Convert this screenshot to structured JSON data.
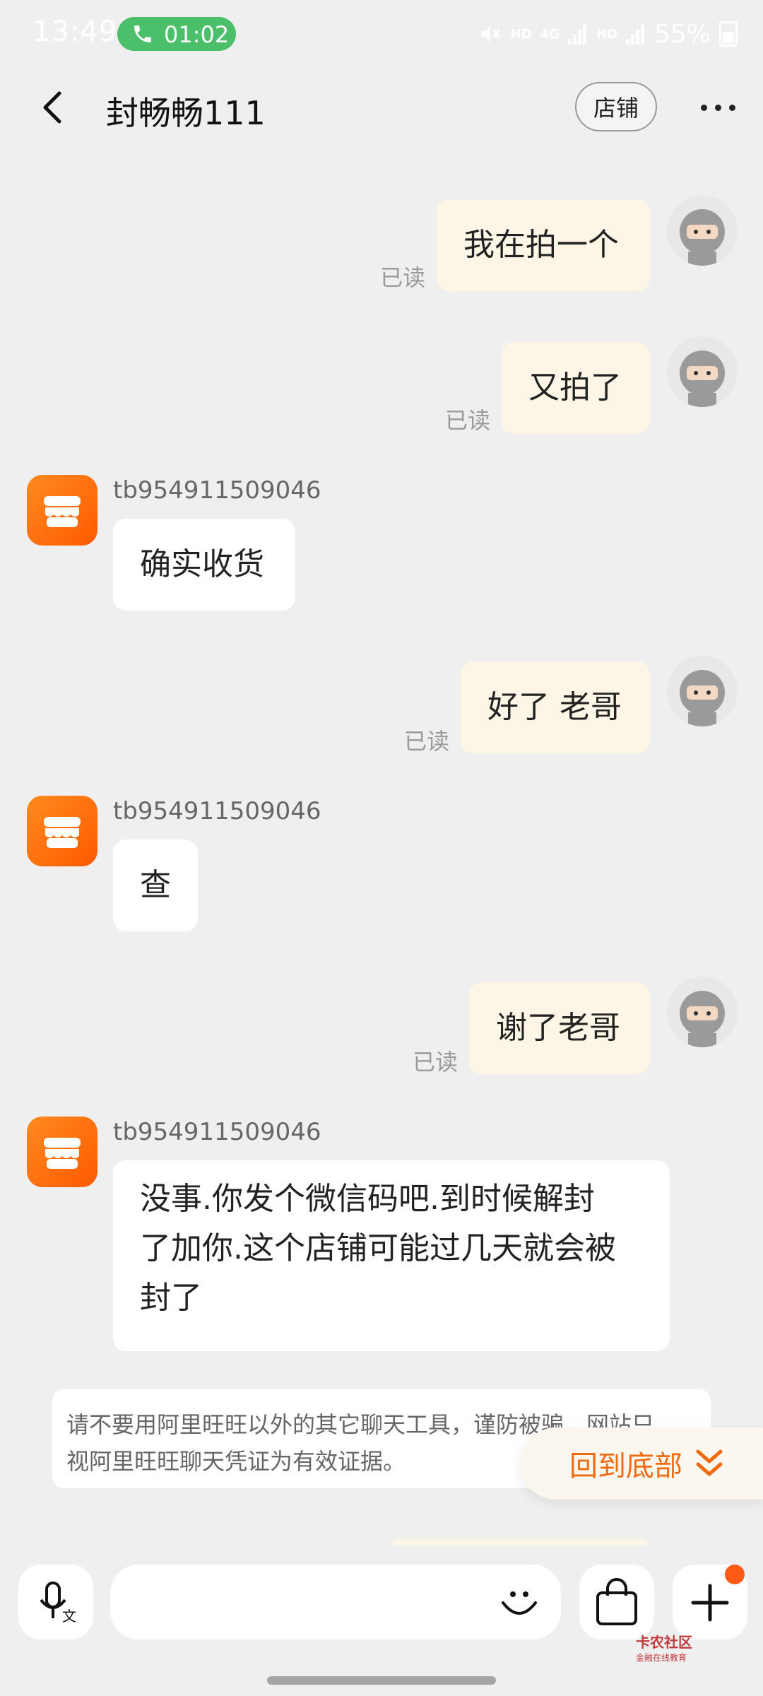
{
  "status_bar": {
    "time": "13:49",
    "call_time": "01:02",
    "network_hd1": "HD",
    "network_4g": "4G",
    "network_hd2": "HD",
    "battery": "55%"
  },
  "header": {
    "title": "封畅畅111",
    "shop_button": "店铺"
  },
  "messages": [
    {
      "direction": "out",
      "text": "我在拍一个",
      "status": "已读"
    },
    {
      "direction": "out",
      "text": "又拍了",
      "status": "已读"
    },
    {
      "direction": "in",
      "sender": "tb954911509046",
      "text": "确实收货"
    },
    {
      "direction": "out",
      "text": "好了 老哥",
      "status": "已读"
    },
    {
      "direction": "in",
      "sender": "tb954911509046",
      "text": "查"
    },
    {
      "direction": "out",
      "text": "谢了老哥",
      "status": "已读"
    },
    {
      "direction": "in",
      "sender": "tb954911509046",
      "text_lines": [
        "没事.你发个微信码吧.到时候解封",
        "了加你.这个店铺可能过几天就会被",
        "封了"
      ]
    }
  ],
  "notice": {
    "line1": "请不要用阿里旺旺以外的其它聊天工具，谨防被骗，网站只",
    "line2": "视阿里旺旺聊天凭证为有效证据。"
  },
  "back_to_bottom": "回到底部",
  "watermark": {
    "title": "卡农社区",
    "subtitle": "金融在线教育"
  },
  "colors": {
    "accent": "#f06a10",
    "outgoing_bubble": "#fdf5e5",
    "call_pill": "#4cbf6b"
  }
}
